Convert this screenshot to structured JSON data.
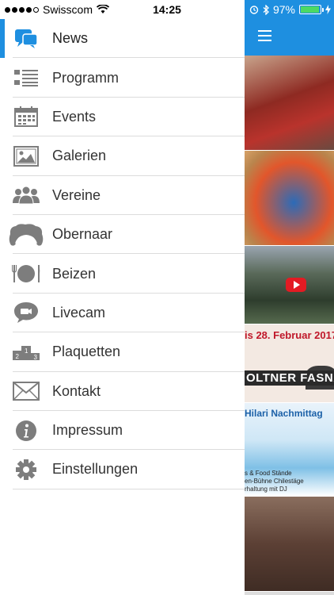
{
  "status": {
    "carrier": "Swisscom",
    "time": "14:25",
    "battery": "97%",
    "battery_level": 0.97
  },
  "menu": {
    "items": [
      {
        "label": "News",
        "icon": "news-icon"
      },
      {
        "label": "Programm",
        "icon": "list-icon"
      },
      {
        "label": "Events",
        "icon": "calendar-icon"
      },
      {
        "label": "Galerien",
        "icon": "gallery-icon"
      },
      {
        "label": "Vereine",
        "icon": "people-icon"
      },
      {
        "label": "Obernaar",
        "icon": "wig-icon"
      },
      {
        "label": "Beizen",
        "icon": "plate-icon"
      },
      {
        "label": "Livecam",
        "icon": "camera-icon"
      },
      {
        "label": "Plaquetten",
        "icon": "podium-icon"
      },
      {
        "label": "Kontakt",
        "icon": "mail-icon"
      },
      {
        "label": "Impressum",
        "icon": "info-icon"
      },
      {
        "label": "Einstellungen",
        "icon": "gear-icon"
      }
    ],
    "active_index": 0
  },
  "content": {
    "poster_date": "is 28. Februar 2017",
    "poster_brand": "OLTNER FASNACHT.CH",
    "event_title": "Hilari Nachmittag",
    "event_lines": [
      "s & Food Stände",
      "en-Bühne Chilestäge",
      "rhaltung mit DJ"
    ]
  },
  "colors": {
    "accent": "#1e8fe0",
    "icon_gray": "#7d7d7d"
  }
}
